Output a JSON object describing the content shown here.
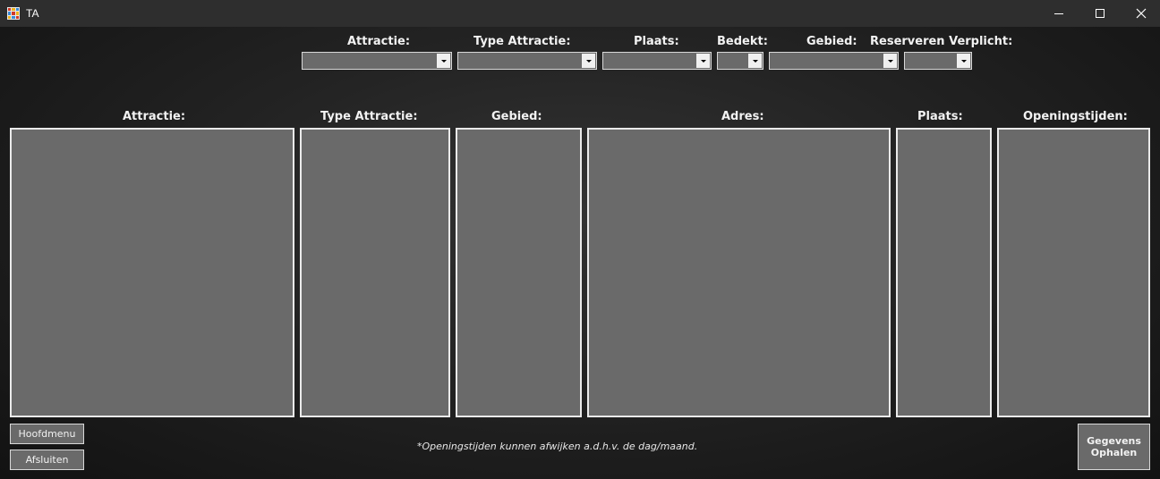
{
  "window": {
    "title": "TA"
  },
  "filters": {
    "attractie_label": "Attractie:",
    "type_label": "Type Attractie:",
    "plaats_label": "Plaats:",
    "bedekt_label": "Bedekt:",
    "gebied_label": "Gebied:",
    "reserveren_label": "Reserveren Verplicht:"
  },
  "columns": {
    "attractie": "Attractie:",
    "type": "Type Attractie:",
    "gebied": "Gebied:",
    "adres": "Adres:",
    "plaats": "Plaats:",
    "openingstijden": "Openingstijden:"
  },
  "buttons": {
    "hoofdmenu": "Hoofdmenu",
    "afsluiten": "Afsluiten",
    "gegevens_ophalen": "Gegevens\nOphalen"
  },
  "footer_note": "*Openingstijden kunnen afwijken a.d.h.v. de dag/maand.",
  "colors": {
    "background": "#1c1c1c",
    "titlebar": "#2e2e2e",
    "control_fill": "#6a6a6a",
    "border": "#eaeaea"
  }
}
